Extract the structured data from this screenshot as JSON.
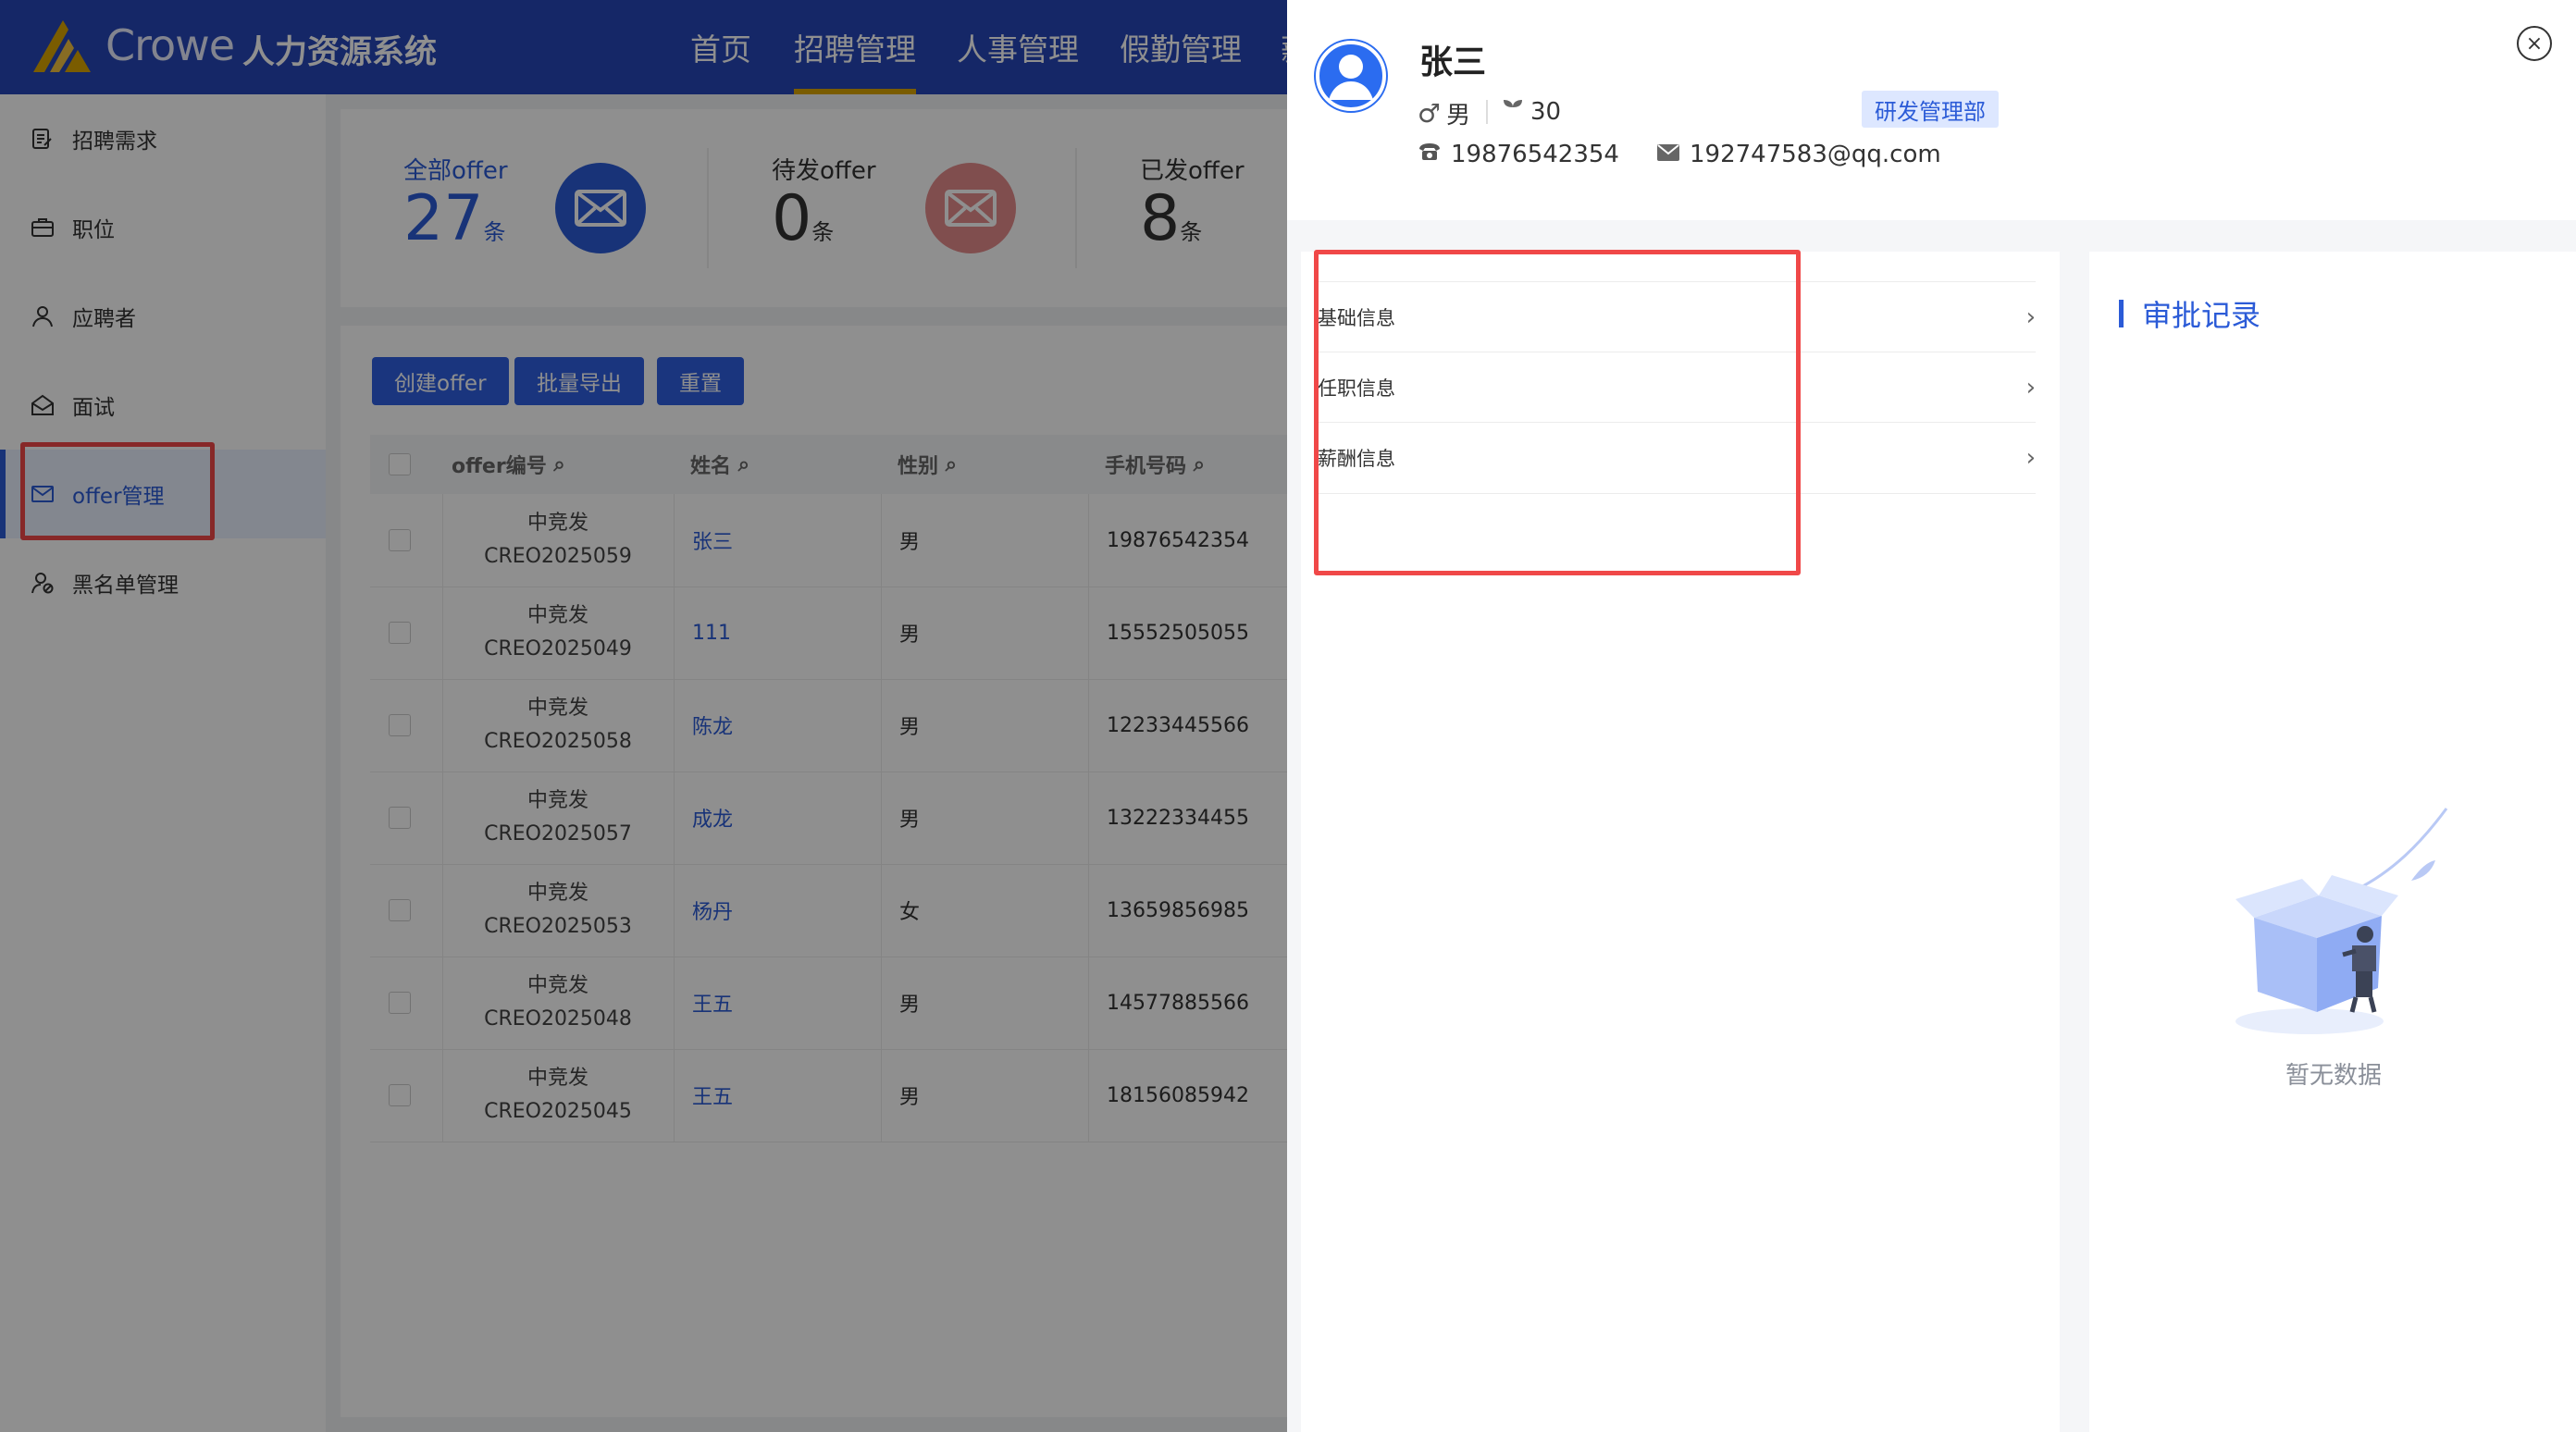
{
  "header": {
    "logo_text": "Crowe",
    "system_title": "人力资源系统",
    "nav": [
      "首页",
      "招聘管理",
      "人事管理",
      "假勤管理",
      "薪"
    ],
    "active_nav_index": 1,
    "accent_color": "#2747b8"
  },
  "sidebar": {
    "items": [
      {
        "label": "招聘需求",
        "icon": "edit-doc-icon"
      },
      {
        "label": "职位",
        "icon": "briefcase-icon"
      },
      {
        "label": "应聘者",
        "icon": "user-icon"
      },
      {
        "label": "面试",
        "icon": "mail-open-icon"
      },
      {
        "label": "offer管理",
        "icon": "mail-icon"
      },
      {
        "label": "黑名单管理",
        "icon": "user-block-icon"
      }
    ],
    "active_index": 4
  },
  "stats": [
    {
      "label": "全部offer",
      "count": "27",
      "unit": "条",
      "color": "#2b5bd7"
    },
    {
      "label": "待发offer",
      "count": "0",
      "unit": "条",
      "color": "#d86a6a"
    },
    {
      "label": "已发offer",
      "count": "8",
      "unit": "条",
      "color": "#333333"
    }
  ],
  "toolbar": {
    "create_label": "创建offer",
    "export_label": "批量导出",
    "reset_label": "重置"
  },
  "table": {
    "headers": [
      "offer编号",
      "姓名",
      "性别",
      "手机号码"
    ],
    "rows": [
      {
        "company": "中竞发",
        "id": "CREO2025059",
        "name": "张三",
        "gender": "男",
        "phone": "19876542354"
      },
      {
        "company": "中竞发",
        "id": "CREO2025049",
        "name": "111",
        "gender": "男",
        "phone": "15552505055"
      },
      {
        "company": "中竞发",
        "id": "CREO2025058",
        "name": "陈龙",
        "gender": "男",
        "phone": "12233445566"
      },
      {
        "company": "中竞发",
        "id": "CREO2025057",
        "name": "成龙",
        "gender": "男",
        "phone": "13222334455"
      },
      {
        "company": "中竞发",
        "id": "CREO2025053",
        "name": "杨丹",
        "gender": "女",
        "phone": "13659856985"
      },
      {
        "company": "中竞发",
        "id": "CREO2025048",
        "name": "王五",
        "gender": "男",
        "phone": "14577885566"
      },
      {
        "company": "中竞发",
        "id": "CREO2025045",
        "name": "王五",
        "gender": "男",
        "phone": "18156085942"
      }
    ]
  },
  "drawer": {
    "name": "张三",
    "gender": "男",
    "age": "30",
    "department": "研发管理部",
    "phone": "19876542354",
    "email": "192747583@qq.com",
    "close_symbol": "×",
    "sections": [
      "基础信息",
      "任职信息",
      "薪酬信息"
    ],
    "approval_title": "审批记录",
    "empty_text": "暂无数据"
  }
}
